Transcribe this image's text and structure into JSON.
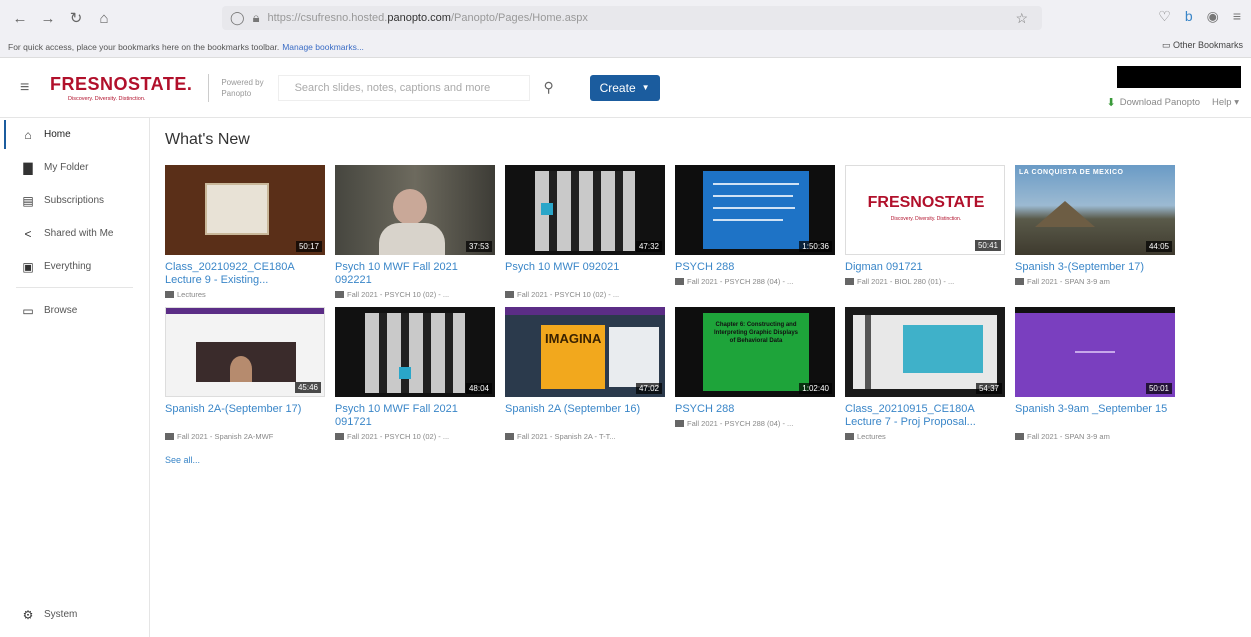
{
  "browser": {
    "url_prefix": "https://csufresno.hosted.",
    "url_host": "panopto.com",
    "url_path": "/Panopto/Pages/Home.aspx",
    "bookmark_text": "For quick access, place your bookmarks here on the bookmarks toolbar.",
    "manage_bookmarks": "Manage bookmarks...",
    "other_bookmarks": "Other Bookmarks"
  },
  "header": {
    "logo": "FRESNOSTATE.",
    "logo_tagline": "Discovery. Diversity. Distinction.",
    "powered_by": "Powered by",
    "powered_brand": "Panopto",
    "search_placeholder": "Search slides, notes, captions and more",
    "create_label": "Create",
    "download_label": "Download Panopto",
    "help_label": "Help"
  },
  "sidebar": {
    "items": [
      {
        "label": "Home",
        "icon": "home-icon"
      },
      {
        "label": "My Folder",
        "icon": "folder-icon"
      },
      {
        "label": "Subscriptions",
        "icon": "subscriptions-icon"
      },
      {
        "label": "Shared with Me",
        "icon": "share-icon"
      },
      {
        "label": "Everything",
        "icon": "everything-icon"
      }
    ],
    "browse": "Browse",
    "system": "System"
  },
  "main": {
    "title": "What's New",
    "see_all": "See all...",
    "videos": [
      {
        "title": "Class_20210922_CE180A Lecture 9 - Existing...",
        "duration": "50:17",
        "folder": "Lectures"
      },
      {
        "title": "Psych 10 MWF Fall 2021 092221",
        "duration": "37:53",
        "folder": "Fall 2021 - PSYCH 10 (02) - ..."
      },
      {
        "title": "Psych 10 MWF 092021",
        "duration": "47:32",
        "folder": "Fall 2021 - PSYCH 10 (02) - ..."
      },
      {
        "title": "PSYCH 288",
        "duration": "1:50:36",
        "folder": "Fall 2021 - PSYCH 288 (04) - ..."
      },
      {
        "title": "Digman 091721",
        "duration": "50:41",
        "folder": "Fall 2021 - BIOL 280 (01) - ..."
      },
      {
        "title": "Spanish 3-(September 17)",
        "duration": "44:05",
        "folder": "Fall 2021 - SPAN 3-9 am"
      },
      {
        "title": "Spanish 2A-(September 17)",
        "duration": "45:46",
        "folder": "Fall 2021 - Spanish 2A-MWF"
      },
      {
        "title": "Psych 10 MWF Fall 2021 091721",
        "duration": "48:04",
        "folder": "Fall 2021 - PSYCH 10 (02) - ..."
      },
      {
        "title": "Spanish 2A (September 16)",
        "duration": "47:02",
        "folder": "Fall 2021 - Spanish 2A - T-T..."
      },
      {
        "title": "PSYCH 288",
        "duration": "1:02:40",
        "folder": "Fall 2021 - PSYCH 288 (04) - ..."
      },
      {
        "title": "Class_20210915_CE180A Lecture 7 - Proj Proposal...",
        "duration": "54:37",
        "folder": "Lectures"
      },
      {
        "title": "Spanish 3-9am _September 15",
        "duration": "50:01",
        "folder": "Fall 2021 - SPAN 3-9 am"
      }
    ],
    "thumb_text": {
      "fresno_logo": "FRESNOSTATE",
      "fresno_tag": "Discovery. Diversity. Distinction.",
      "conquista": "LA CONQUISTA DE MEXICO",
      "imagina": "IMAGINA",
      "chapter": "Chapter 6: Constructing and Interpreting Graphic Displays of Behavioral Data"
    }
  },
  "colors": {
    "brand_red": "#b1102b",
    "link_blue": "#3a86c8",
    "create_blue": "#1b5c9e"
  }
}
